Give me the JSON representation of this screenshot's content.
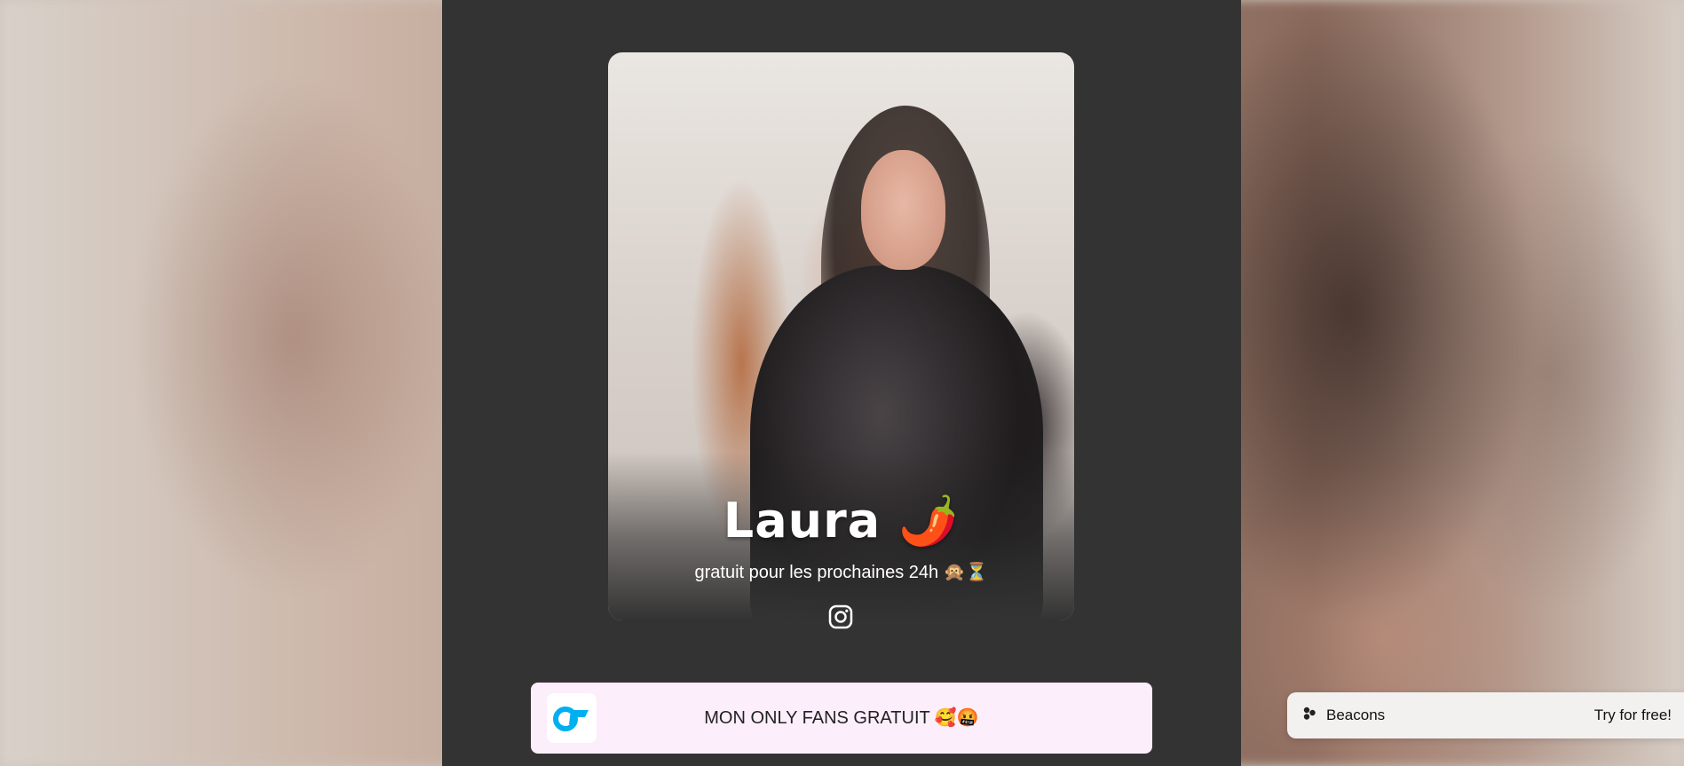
{
  "profile": {
    "name": "Laura 🌶️",
    "bio": "gratuit pour les prochaines 24h 🙊⏳",
    "social": {
      "icon": "instagram-icon"
    }
  },
  "links": [
    {
      "icon": "onlyfans-icon",
      "label": "MON ONLY FANS GRATUIT 🥰🤬"
    }
  ],
  "footer": {
    "brand": "Beacons",
    "brand_icon": "beacons-logo-icon",
    "cta": "Try for free!"
  },
  "colors": {
    "panel": "#333333",
    "link_button": "#fdeefb",
    "onlyfans_blue": "#00aff0"
  }
}
